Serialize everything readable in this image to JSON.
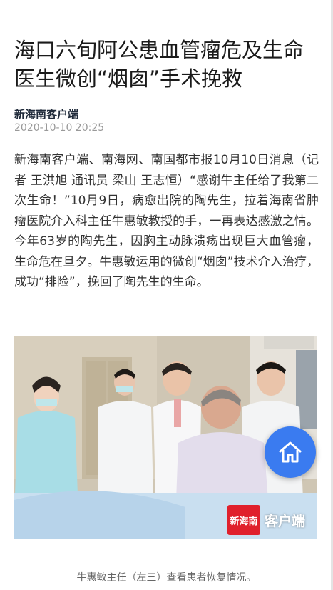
{
  "article": {
    "title": "海口六旬阿公患血管瘤危及生命 医生微创“烟囱”手术挽救",
    "source": "新海南客户端",
    "time": "2020-10-10 20:25",
    "body": "新海南客户端、南海网、南国都市报10月10日消息（记者 王洪旭 通讯员 梁山 王志恒）“感谢牛主任给了我第二次生命！”10月9日，病愈出院的陶先生，拉着海南省肿瘤医院介入科主任牛惠敏教授的手，一再表达感激之情。今年63岁的陶先生，因胸主动脉溃疡出现巨大血管瘤，生命危在旦夕。牛惠敏运用的微创“烟囱”技术介入治疗，成功“排险”，挽回了陶先生的生命。",
    "caption": "牛惠敏主任（左三）查看患者恢复情况。"
  },
  "photo": {
    "watermark_logo": "新海南",
    "watermark_text": "客户端"
  },
  "home_button": {
    "icon": "home-icon"
  },
  "colors": {
    "accent": "#3a7bf0",
    "logo_red": "#e0202c"
  }
}
